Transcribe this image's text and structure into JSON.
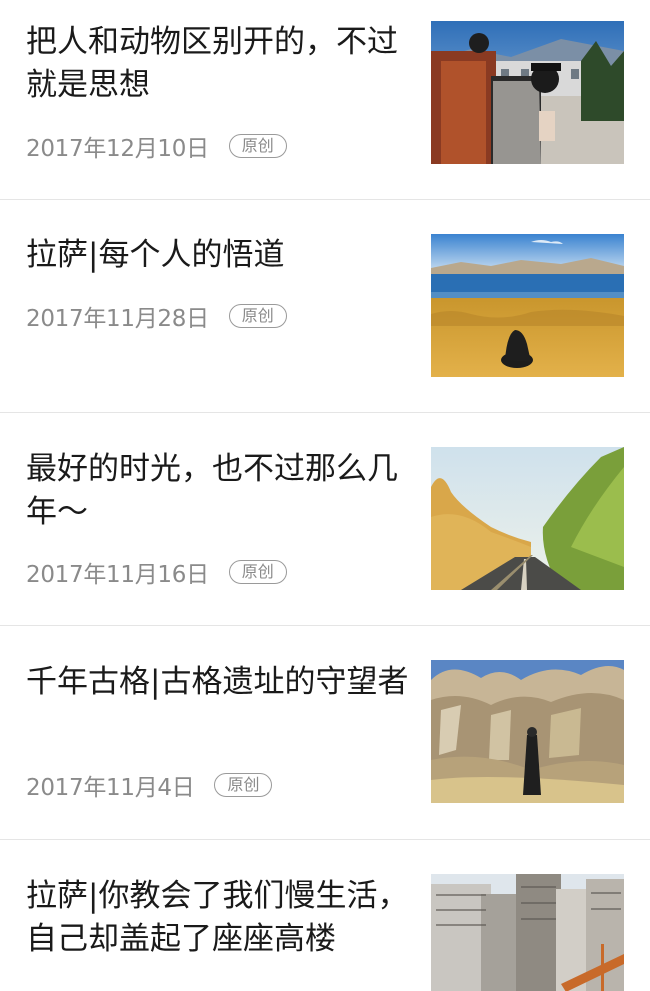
{
  "articles": [
    {
      "title": "把人和动物区别开的，不过就是思想",
      "date": "2017年12月10日",
      "badge": "原创",
      "thumbnail": "hiker-photo"
    },
    {
      "title": "拉萨|每个人的悟道",
      "date": "2017年11月28日",
      "badge": "原创",
      "thumbnail": "lake-grassland-photo"
    },
    {
      "title": "最好的时光，也不过那么几年～",
      "date": "2017年11月16日",
      "badge": "原创",
      "thumbnail": "autumn-road-photo"
    },
    {
      "title": "千年古格|古格遗址的守望者",
      "date": "2017年11月4日",
      "badge": "原创",
      "thumbnail": "ruins-photo"
    },
    {
      "title": "拉萨|你教会了我们慢生活，自己却盖起了座座高楼",
      "date": "",
      "badge": "",
      "thumbnail": "city-buildings-photo"
    }
  ]
}
